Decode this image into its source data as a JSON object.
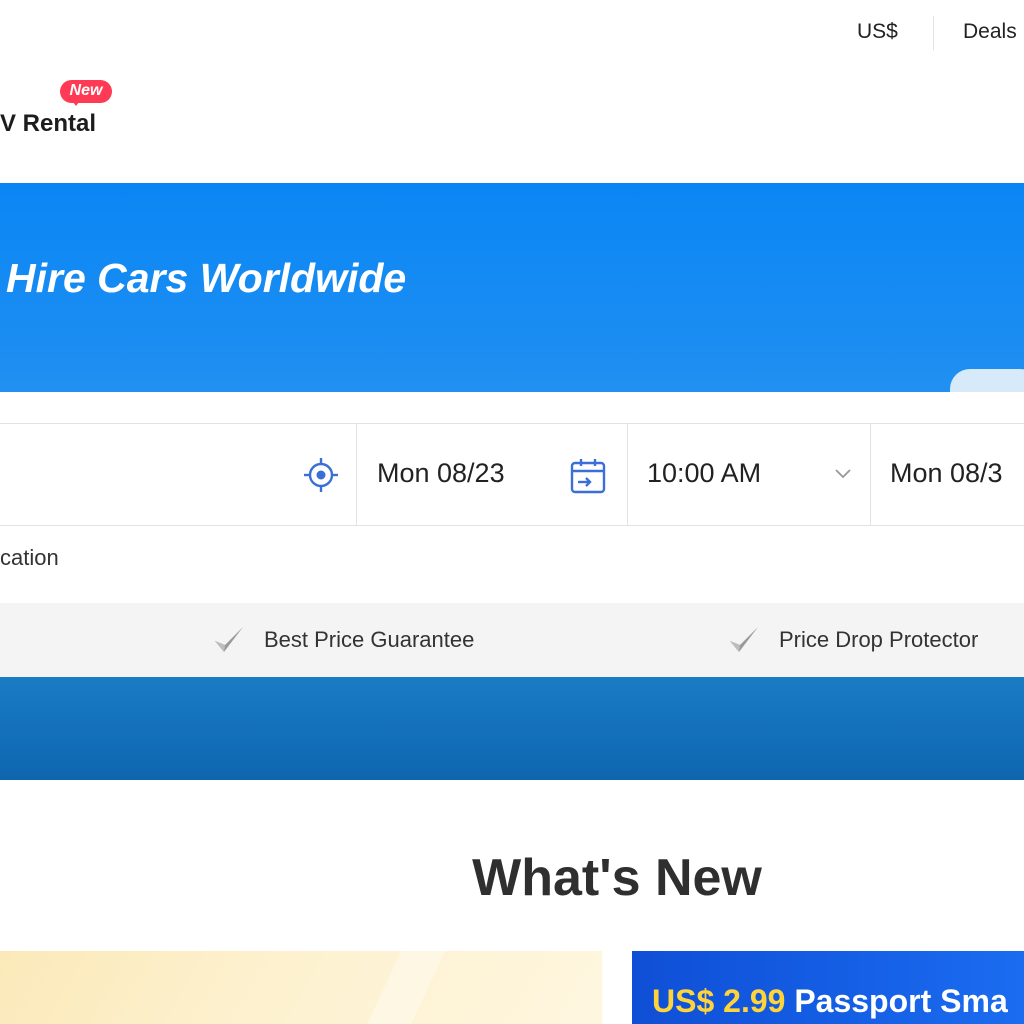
{
  "header": {
    "currency": "US$",
    "deals": "Deals"
  },
  "nav": {
    "tab_label": "V Rental",
    "new_badge": "New"
  },
  "hero": {
    "title": "Hire Cars Worldwide"
  },
  "search": {
    "pickup_date": "Mon 08/23",
    "pickup_time": "10:00 AM",
    "return_date": "Mon 08/3",
    "location_option_label": "cation",
    "icons": {
      "locate": "crosshair-locate-icon",
      "calendar": "calendar-icon",
      "time_dropdown": "chevron-down-icon"
    }
  },
  "guarantees": [
    {
      "label": "Best Price Guarantee",
      "icon": "check-icon"
    },
    {
      "label": "Price Drop Protector",
      "icon": "check-icon"
    }
  ],
  "whats_new": {
    "title": "What's New",
    "promo_right": {
      "price": "US$ 2.99",
      "name": " Passport Sma"
    }
  },
  "colors": {
    "brand_blue": "#0a86f4",
    "badge_red": "#ff3a55",
    "icon_blue": "#3a6fd8",
    "promo_price_yellow": "#ffd43b"
  }
}
